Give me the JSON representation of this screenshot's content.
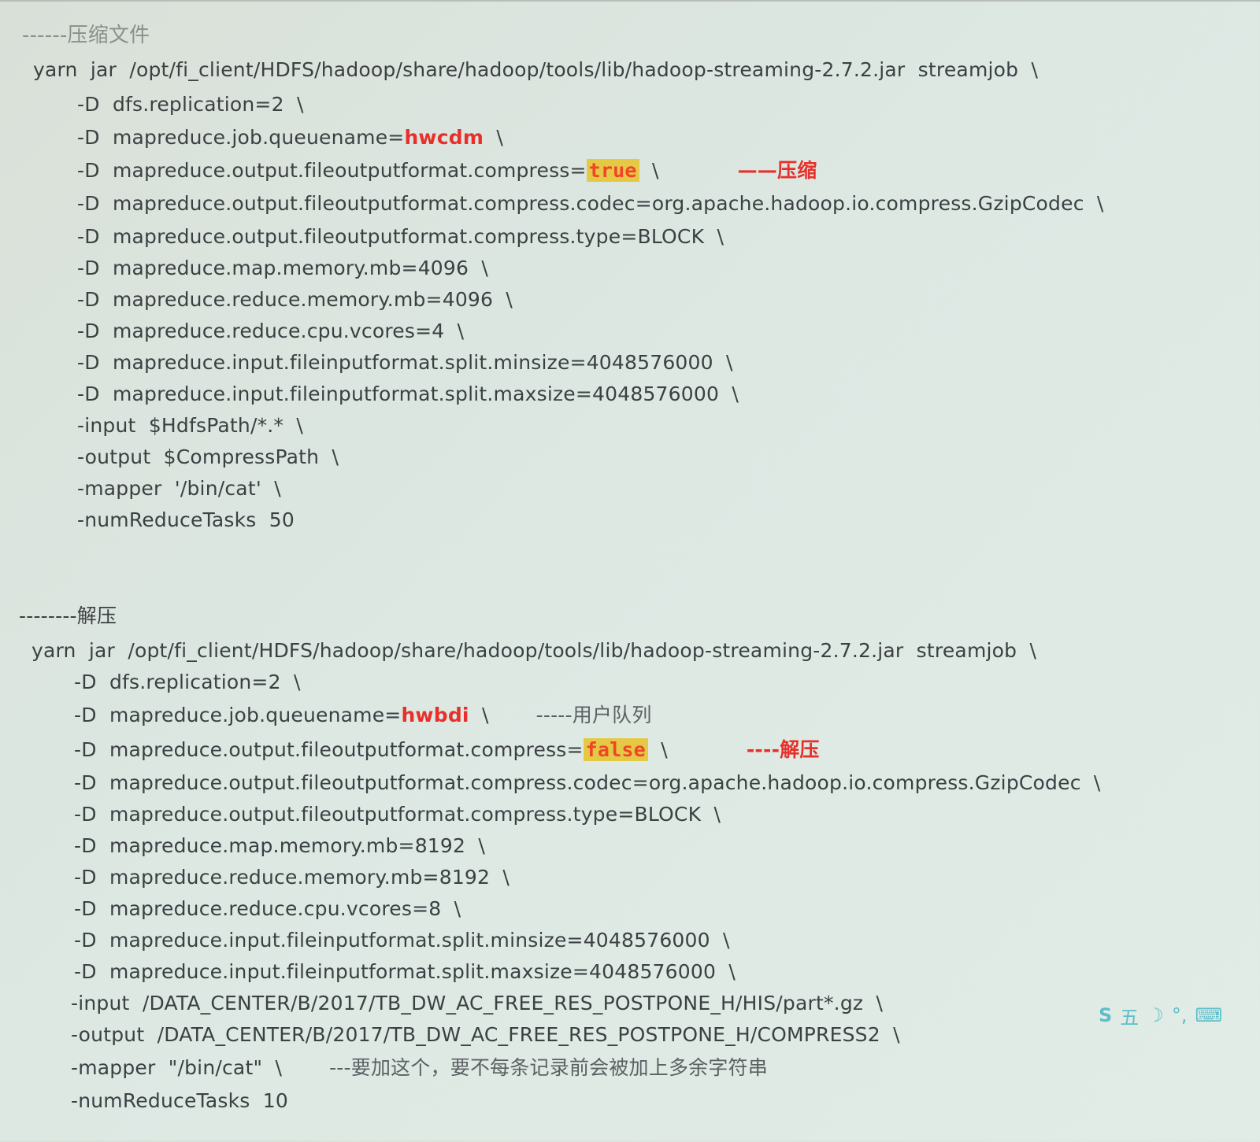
{
  "compress": {
    "header": "------压缩文件",
    "cmd": "yarn  jar  /opt/fi_client/HDFS/hadoop/share/hadoop/tools/lib/hadoop-streaming-2.7.2.jar  streamjob  \\",
    "l1": "-D  dfs.replication=2  \\",
    "l2_pre": "-D  mapreduce.job.queuename=",
    "l2_val": "hwcdm",
    "l2_post": "  \\",
    "l3_pre": "-D  mapreduce.output.fileoutputformat.compress=",
    "l3_val": "true",
    "l3_post": "  \\",
    "l3_note": "——压缩",
    "l4": "-D  mapreduce.output.fileoutputformat.compress.codec=org.apache.hadoop.io.compress.GzipCodec  \\",
    "l5": "-D  mapreduce.output.fileoutputformat.compress.type=BLOCK  \\",
    "l6": "-D  mapreduce.map.memory.mb=4096  \\",
    "l7": "-D  mapreduce.reduce.memory.mb=4096  \\",
    "l8": "-D  mapreduce.reduce.cpu.vcores=4  \\",
    "l9": "-D  mapreduce.input.fileinputformat.split.minsize=4048576000  \\",
    "l10": "-D  mapreduce.input.fileinputformat.split.maxsize=4048576000  \\",
    "l11": "-input  $HdfsPath/*.*  \\",
    "l12": "-output  $CompressPath  \\",
    "l13": "-mapper  '/bin/cat'  \\",
    "l14": "-numReduceTasks  50"
  },
  "decompress": {
    "header": "--------解压",
    "cmd": "yarn  jar  /opt/fi_client/HDFS/hadoop/share/hadoop/tools/lib/hadoop-streaming-2.7.2.jar  streamjob  \\",
    "l1": "-D  dfs.replication=2  \\",
    "l2_pre": "-D  mapreduce.job.queuename=",
    "l2_val": "hwbdi",
    "l2_post": "  \\",
    "l2_note": "-----用户队列",
    "l3_pre": "-D  mapreduce.output.fileoutputformat.compress=",
    "l3_val": "false",
    "l3_post": "  \\",
    "l3_note": "----解压",
    "l4": "-D  mapreduce.output.fileoutputformat.compress.codec=org.apache.hadoop.io.compress.GzipCodec  \\",
    "l5": "-D  mapreduce.output.fileoutputformat.compress.type=BLOCK  \\",
    "l6": "-D  mapreduce.map.memory.mb=8192  \\",
    "l7": "-D  mapreduce.reduce.memory.mb=8192  \\",
    "l8": "-D  mapreduce.reduce.cpu.vcores=8  \\",
    "l9": "-D  mapreduce.input.fileinputformat.split.minsize=4048576000  \\",
    "l10": "-D  mapreduce.input.fileinputformat.split.maxsize=4048576000  \\",
    "l11": "-input  /DATA_CENTER/B/2017/TB_DW_AC_FREE_RES_POSTPONE_H/HIS/part*.gz  \\",
    "l12": "-output  /DATA_CENTER/B/2017/TB_DW_AC_FREE_RES_POSTPONE_H/COMPRESS2  \\",
    "l13": "-mapper  \"/bin/cat\"  \\",
    "l13_note": "---要加这个，要不每条记录前会被加上多余字符串",
    "l14": "-numReduceTasks  10"
  },
  "ime": {
    "logo": "S",
    "mode": "五",
    "moon": "☽",
    "punct": "°,",
    "keyboard": "⌨"
  }
}
